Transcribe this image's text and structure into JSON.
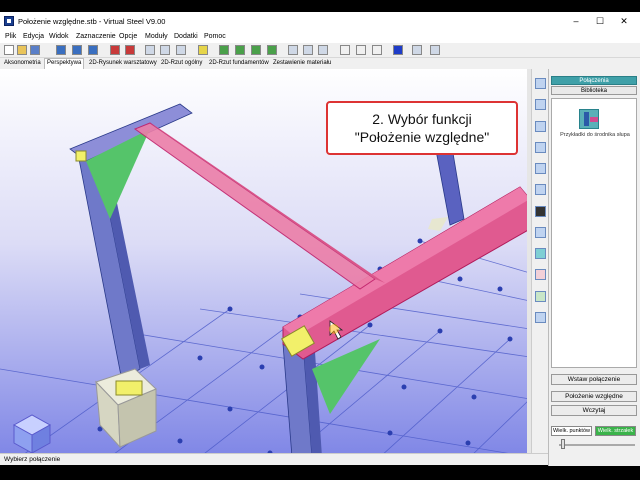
{
  "window": {
    "title": "Położenie względne.stb - Virtual Steel V9.00",
    "minimize": "–",
    "maximize": "☐",
    "close": "✕"
  },
  "menu": [
    "Plik",
    "Edycja",
    "Widok",
    "Zaznaczenie",
    "Opcje",
    "Moduły",
    "Dodatki",
    "Pomoc"
  ],
  "view_tabs": [
    "Aksonometria",
    "Perspektywa",
    "2D-Rysunek warsztatowy",
    "2D-Rzut ogólny",
    "2D-Rzut fundamentów",
    "Zestawienie materiału"
  ],
  "active_view_tab": "Perspektywa",
  "callout": {
    "line1": "2. Wybór funkcji",
    "line2": "\"Położenie względne\""
  },
  "right_panel": {
    "tab_connections": "Połączenia",
    "tab_library": "Biblioteka",
    "connection_item": "Przykładki do środnika słupa",
    "insert_button": "Wstaw połączenie",
    "relative_position_button": "Położenie względne",
    "load_button": "Wczytaj",
    "point_size_button": "Wielk. punktów",
    "arrow_size_button": "Wielk. strzałek"
  },
  "status": {
    "text": "Wybierz połączenie"
  },
  "colors": {
    "accent_teal": "#3fa0a8",
    "beam_pink": "#e05a90",
    "column_blue": "#6f79c9",
    "callout_border": "#dd3333",
    "grid_blue": "#2b3fb0"
  }
}
